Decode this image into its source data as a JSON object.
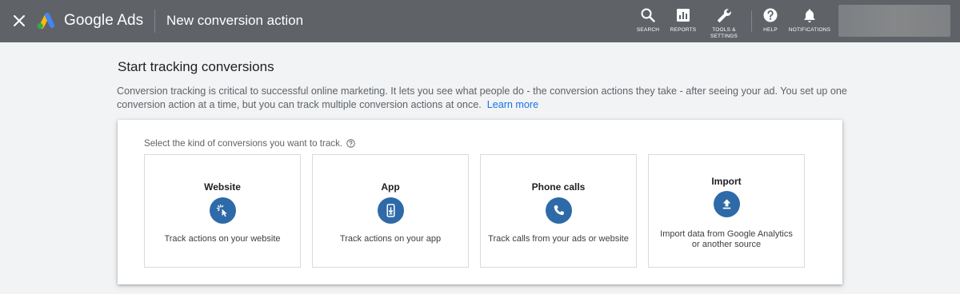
{
  "header": {
    "product_name": "Google Ads",
    "page_title": "New conversion action",
    "tools": {
      "search": "SEARCH",
      "reports": "REPORTS",
      "tools_line1": "TOOLS &",
      "tools_line2": "SETTINGS",
      "help": "HELP",
      "notifications": "NOTIFICATIONS"
    },
    "icons": [
      "close-icon",
      "google-ads-logo",
      "search-icon",
      "reports-icon",
      "wrench-icon",
      "help-icon",
      "bell-icon"
    ]
  },
  "main": {
    "heading": "Start tracking conversions",
    "description": "Conversion tracking is critical to successful online marketing. It lets you see what people do - the conversion actions they take - after seeing your ad. You set up one conversion action at a time, but you can track multiple conversion actions at once.",
    "learn_more": "Learn more",
    "prompt": "Select the kind of conversions you want to track.",
    "options": [
      {
        "title": "Website",
        "description": "Track actions on your website",
        "icon": "click-cursor-icon"
      },
      {
        "title": "App",
        "description": "Track actions on your app",
        "icon": "mobile-download-icon"
      },
      {
        "title": "Phone calls",
        "description": "Track calls from your ads or website",
        "icon": "phone-icon"
      },
      {
        "title": "Import",
        "description": "Import data from Google Analytics or another source",
        "icon": "upload-icon"
      }
    ]
  },
  "colors": {
    "topbar": "#5f6368",
    "background": "#f1f3f4",
    "link": "#1a73e8",
    "option_icon": "#2e6aa8"
  }
}
